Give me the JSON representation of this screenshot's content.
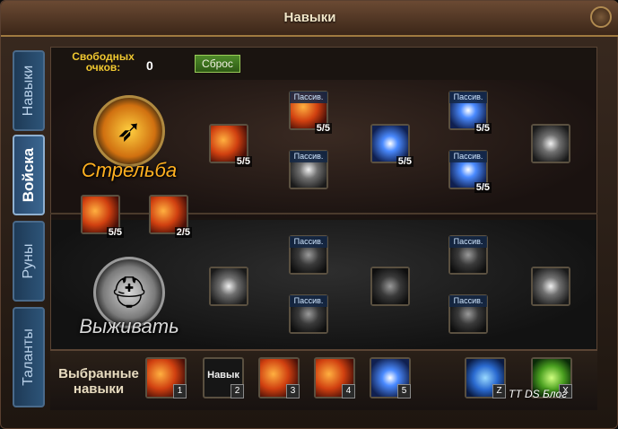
{
  "window": {
    "title": "Навыки"
  },
  "side_tabs": [
    {
      "label": "Навыки"
    },
    {
      "label": "Войска"
    },
    {
      "label": "Руны"
    },
    {
      "label": "Таланты"
    }
  ],
  "header": {
    "free_points_label": "Свободных очков:",
    "free_points_value": "0",
    "reset_label": "Сброс"
  },
  "classes": {
    "top": {
      "name": "Стрельба",
      "icon": "arrow-emblem-icon"
    },
    "bottom": {
      "name": "Выживать",
      "icon": "helmet-emblem-icon"
    }
  },
  "skills": [
    {
      "tag": "",
      "level": "5/5",
      "style": "red",
      "icon": "fire-arrows-icon"
    },
    {
      "tag": "Пассив.",
      "level": "5/5",
      "style": "red",
      "icon": "fire-warrior-icon"
    },
    {
      "tag": "Пассив.",
      "level": "",
      "style": "grey",
      "icon": "crossed-arrows-icon"
    },
    {
      "tag": "",
      "level": "5/5",
      "style": "blue",
      "icon": "blue-burst-icon"
    },
    {
      "tag": "Пассив.",
      "level": "5/5",
      "style": "blue",
      "icon": "blue-crossed-icon"
    },
    {
      "tag": "Пассив.",
      "level": "5/5",
      "style": "blue",
      "icon": "blue-warrior-icon"
    },
    {
      "tag": "",
      "level": "",
      "style": "grey",
      "icon": "white-arrow-icon"
    },
    {
      "tag": "",
      "level": "5/5",
      "style": "red",
      "icon": "fire-bolt-icon"
    },
    {
      "tag": "",
      "level": "2/5",
      "style": "red",
      "icon": "triple-fire-bolt-icon"
    },
    {
      "tag": "",
      "level": "",
      "style": "grey",
      "icon": "grey-arrows-icon"
    },
    {
      "tag": "Пассив.",
      "level": "",
      "style": "dark",
      "icon": "grey-warrior-icon"
    },
    {
      "tag": "Пассив.",
      "level": "",
      "style": "dark",
      "icon": "grey-burst-icon"
    },
    {
      "tag": "",
      "level": "",
      "style": "dark",
      "icon": "grey-rain-icon"
    },
    {
      "tag": "Пассив.",
      "level": "",
      "style": "dark",
      "icon": "grey-explosion-icon"
    },
    {
      "tag": "Пассив.",
      "level": "",
      "style": "dark",
      "icon": "grey-swirl-icon"
    },
    {
      "tag": "",
      "level": "",
      "style": "grey",
      "icon": "grey-comet-icon"
    }
  ],
  "chosen": {
    "label": "Выбранные навыки",
    "slots": [
      {
        "num": "1",
        "style": "red",
        "text": "",
        "icon": "fire-bolt-icon"
      },
      {
        "num": "2",
        "style": "empty",
        "text": "Навык",
        "icon": ""
      },
      {
        "num": "3",
        "style": "red",
        "text": "",
        "icon": "fire-arrows-icon"
      },
      {
        "num": "4",
        "style": "red",
        "text": "",
        "icon": "fire-arrows-icon"
      },
      {
        "num": "5",
        "style": "blue",
        "text": "",
        "icon": "blue-burst-icon"
      },
      {
        "num": "Z",
        "style": "shield",
        "text": "",
        "icon": "blue-shield-icon"
      },
      {
        "num": "X",
        "style": "greenshield",
        "text": "",
        "icon": "green-shield-icon"
      }
    ]
  },
  "watermark": "TT DS Блог",
  "colors": {
    "accent_gold": "#f0c830",
    "fire_orange": "#ffb020",
    "tab_blue": "#2d5478"
  }
}
